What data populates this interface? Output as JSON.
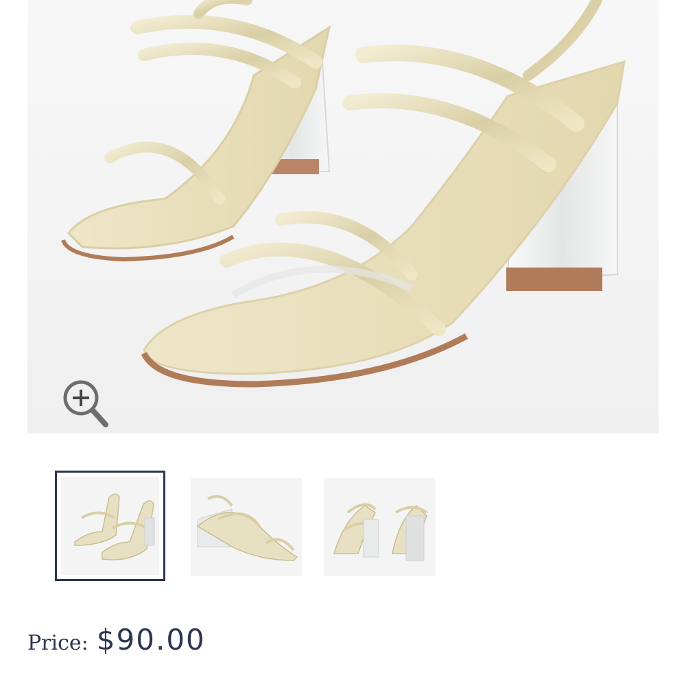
{
  "product": {
    "price_label": "Price:",
    "price_value": "$90.00"
  },
  "gallery": {
    "selected_index": 0,
    "thumbnail_count": 3
  },
  "icons": {
    "zoom": "zoom-in-magnifier-icon"
  },
  "colors": {
    "text": "#2b3650",
    "selected_border": "#2b3650",
    "background": "#ffffff"
  }
}
